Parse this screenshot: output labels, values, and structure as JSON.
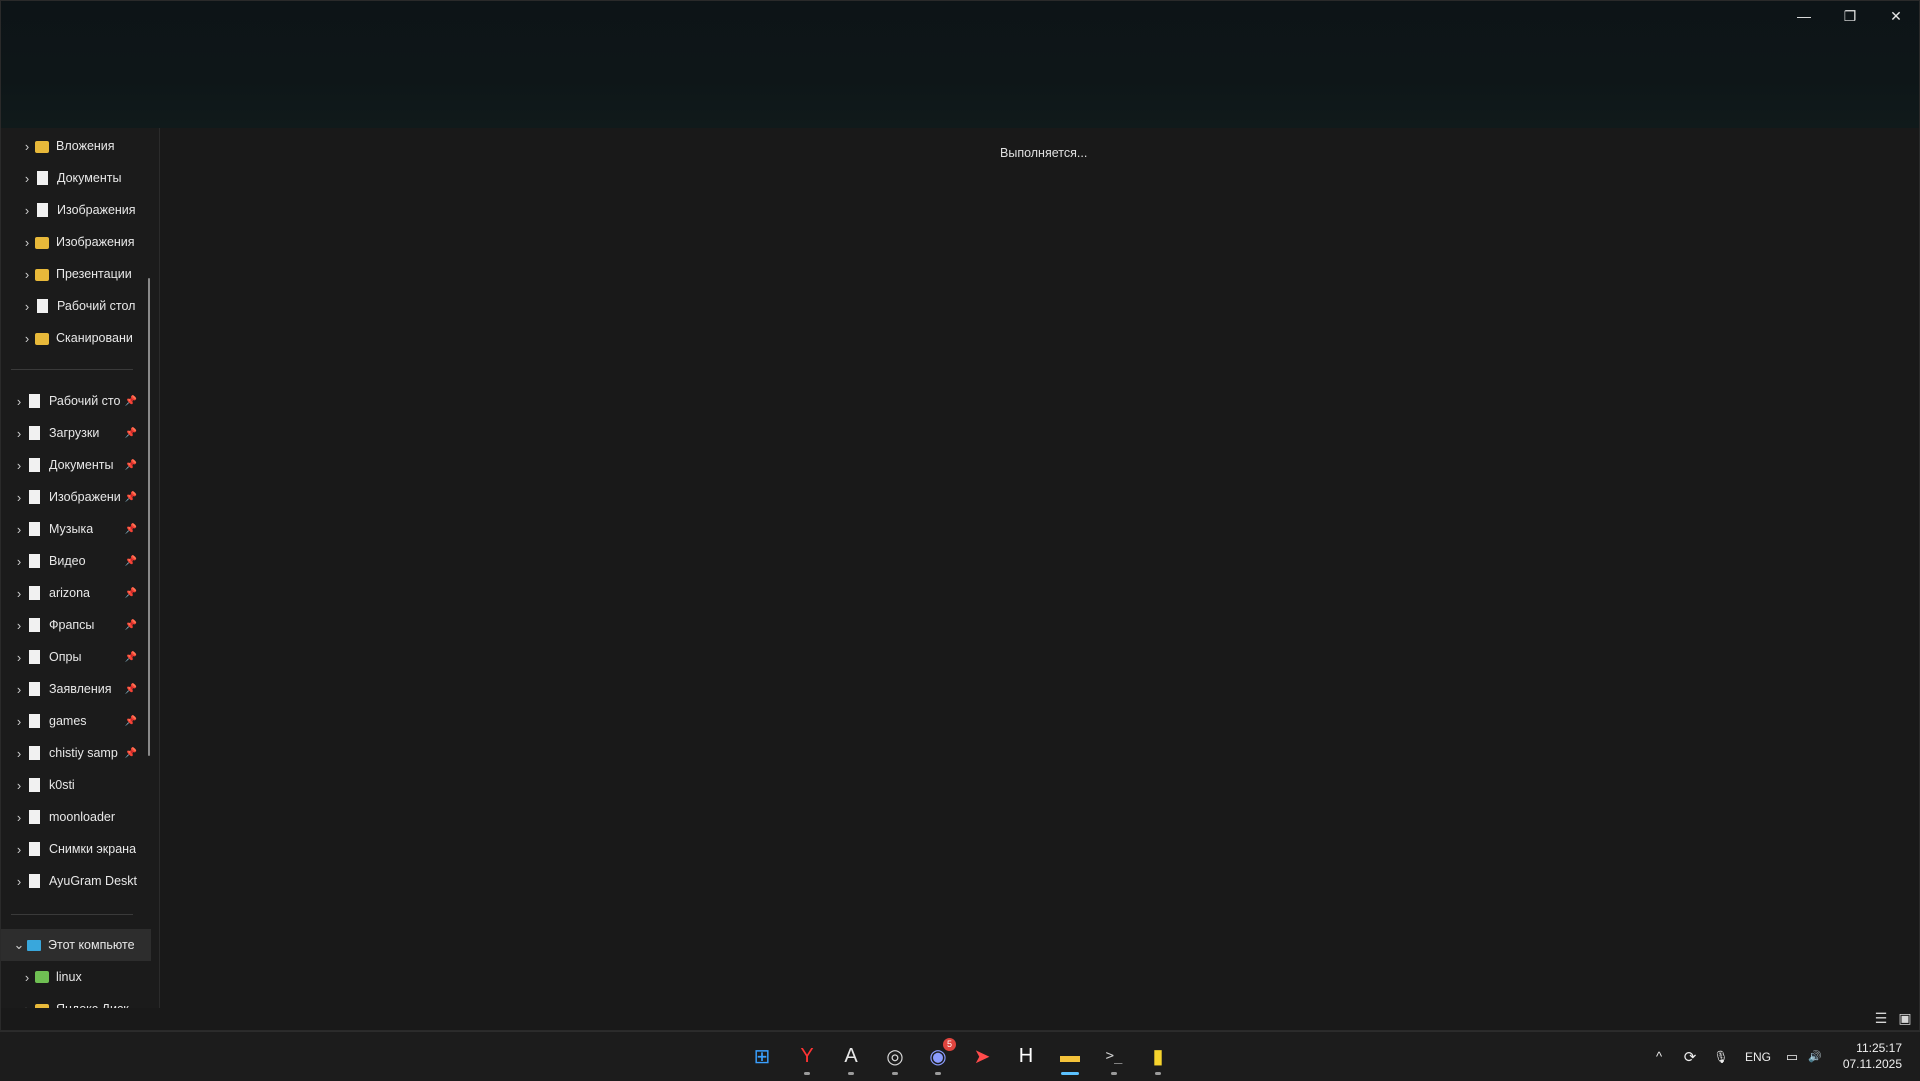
{
  "window": {
    "controls": {
      "minimize": "—",
      "maximize": "❐",
      "close": "✕"
    }
  },
  "sidebar": {
    "group_user": [
      {
        "label": "Вложения",
        "icon": "folder-icon"
      },
      {
        "label": "Документы",
        "icon": "document-icon"
      },
      {
        "label": "Изображения",
        "icon": "document-icon"
      },
      {
        "label": "Изображения",
        "icon": "folder-icon"
      },
      {
        "label": "Презентации",
        "icon": "folder-icon"
      },
      {
        "label": "Рабочий стол",
        "icon": "document-icon"
      },
      {
        "label": "Сканировани",
        "icon": "folder-icon"
      }
    ],
    "group_pinned": [
      {
        "label": "Рабочий сто",
        "pinned": true
      },
      {
        "label": "Загрузки",
        "pinned": true
      },
      {
        "label": "Документы",
        "pinned": true
      },
      {
        "label": "Изображени",
        "pinned": true
      },
      {
        "label": "Музыка",
        "pinned": true
      },
      {
        "label": "Видео",
        "pinned": true
      },
      {
        "label": "arizona",
        "pinned": true
      },
      {
        "label": "Фрапсы",
        "pinned": true
      },
      {
        "label": "Опры",
        "pinned": true
      },
      {
        "label": "Заявления",
        "pinned": true
      },
      {
        "label": "games",
        "pinned": true
      },
      {
        "label": "chistiy samp",
        "pinned": true
      },
      {
        "label": "k0sti",
        "pinned": false
      },
      {
        "label": "moonloader",
        "pinned": false
      },
      {
        "label": "Снимки экрана",
        "pinned": false
      },
      {
        "label": "AyuGram Deskt",
        "pinned": false
      }
    ],
    "this_pc": {
      "label": "Этот компьюте",
      "expanded": true
    },
    "drives": [
      {
        "label": "linux"
      },
      {
        "label": "Яндекс.Диск"
      }
    ],
    "pin_glyph": "📌"
  },
  "content": {
    "status_text": "Выполняется..."
  },
  "statusbar": {
    "view_details": "☰",
    "view_tiles": "▣"
  },
  "taskbar": {
    "apps": [
      {
        "name": "start",
        "glyph": "⊞"
      },
      {
        "name": "yandex-browser",
        "glyph": "Y"
      },
      {
        "name": "app-a",
        "glyph": "A"
      },
      {
        "name": "chrome-like",
        "glyph": "◎"
      },
      {
        "name": "discord",
        "glyph": "◉",
        "badge": "5"
      },
      {
        "name": "telegram",
        "glyph": "➤"
      },
      {
        "name": "app-h",
        "glyph": "H"
      },
      {
        "name": "file-explorer",
        "glyph": "▬"
      },
      {
        "name": "terminal",
        "glyph": ">_"
      },
      {
        "name": "app-yellow",
        "glyph": "▮"
      }
    ],
    "tray": {
      "chevron": "^",
      "sync": "⟳",
      "mic": "🎙",
      "lang": "ENG",
      "network": "▭",
      "volume": "🔊"
    },
    "clock": {
      "time": "11:25:17",
      "date": "07.11.2025"
    }
  }
}
